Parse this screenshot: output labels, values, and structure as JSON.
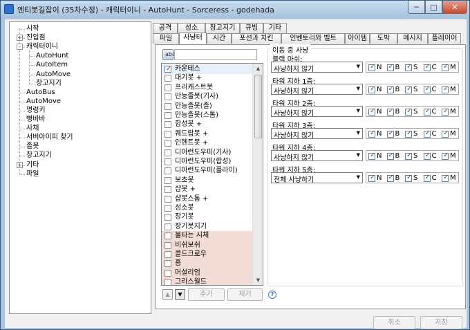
{
  "window": {
    "title": "엔티봇길잡이 (35차수정) - 캐릭터이니 - AutoHunt - Sorceress - godehada",
    "min_glyph": "─",
    "max_glyph": "□",
    "close_glyph": "✕"
  },
  "tree": {
    "items": [
      {
        "label": "시작",
        "level": 0,
        "expander": ""
      },
      {
        "label": "진입점",
        "level": 0,
        "expander": "+"
      },
      {
        "label": "캐릭터이니",
        "level": 0,
        "expander": "-"
      },
      {
        "label": "AutoHunt",
        "level": 1,
        "expander": ""
      },
      {
        "label": "AutoItem",
        "level": 1,
        "expander": ""
      },
      {
        "label": "AutoMove",
        "level": 1,
        "expander": ""
      },
      {
        "label": "창고지기",
        "level": 1,
        "expander": ""
      },
      {
        "label": "AutoBus",
        "level": 0,
        "expander": ""
      },
      {
        "label": "AutoMove",
        "level": 0,
        "expander": ""
      },
      {
        "label": "명령키",
        "level": 0,
        "expander": ""
      },
      {
        "label": "뻥바바",
        "level": 0,
        "expander": ""
      },
      {
        "label": "사채",
        "level": 0,
        "expander": ""
      },
      {
        "label": "서버아이피 찾기",
        "level": 0,
        "expander": ""
      },
      {
        "label": "졸봇",
        "level": 0,
        "expander": ""
      },
      {
        "label": "창고지기",
        "level": 0,
        "expander": ""
      },
      {
        "label": "기타",
        "level": 0,
        "expander": "+"
      },
      {
        "label": "파일",
        "level": 0,
        "expander": ""
      }
    ]
  },
  "tabs": {
    "row1": [
      "공격",
      "성소",
      "창고지기",
      "큐빙",
      "기타"
    ],
    "row2": [
      "파일",
      "사냥터",
      "시간",
      "포션과 치킨",
      "인벤토리와 벨트",
      "아이템",
      "도박",
      "메시지",
      "플레이어"
    ],
    "active": "사냥터"
  },
  "hunt_list": {
    "items": [
      {
        "label": "카운테스",
        "checked": true,
        "highlight": false
      },
      {
        "label": "대기봇 +",
        "checked": false,
        "highlight": false
      },
      {
        "label": "프리캐스트봇",
        "checked": false,
        "highlight": false
      },
      {
        "label": "만능졸봇(기사)",
        "checked": false,
        "highlight": false
      },
      {
        "label": "만능졸봇(졸)",
        "checked": false,
        "highlight": false
      },
      {
        "label": "만능졸봇(스톰)",
        "checked": false,
        "highlight": false
      },
      {
        "label": "합성봇 +",
        "checked": false,
        "highlight": false
      },
      {
        "label": "퀘드랍봇 +",
        "checked": false,
        "highlight": false
      },
      {
        "label": "인헨트봇 +",
        "checked": false,
        "highlight": false
      },
      {
        "label": "디아런도우미(기사)",
        "checked": false,
        "highlight": false
      },
      {
        "label": "디아런도우미(합성)",
        "checked": false,
        "highlight": false
      },
      {
        "label": "디아런도우미(플라이)",
        "checked": false,
        "highlight": false
      },
      {
        "label": "보초봇",
        "checked": false,
        "highlight": false
      },
      {
        "label": "샵봇 +",
        "checked": false,
        "highlight": false
      },
      {
        "label": "샵봇스톰 +",
        "checked": false,
        "highlight": false
      },
      {
        "label": "성소봇",
        "checked": false,
        "highlight": false
      },
      {
        "label": "장기봇",
        "checked": false,
        "highlight": false
      },
      {
        "label": "장기봇지기",
        "checked": false,
        "highlight": false
      },
      {
        "label": "불타는 시체",
        "checked": false,
        "highlight": true
      },
      {
        "label": "비쉬보쉬",
        "checked": false,
        "highlight": true
      },
      {
        "label": "콜드크로우",
        "checked": false,
        "highlight": true
      },
      {
        "label": "홈",
        "checked": false,
        "highlight": true
      },
      {
        "label": "머설리엄",
        "checked": false,
        "highlight": true
      },
      {
        "label": "그리스월드",
        "checked": false,
        "highlight": true
      }
    ]
  },
  "buttons": {
    "up_glyph": "▲",
    "down_glyph": "▼",
    "add": "추가",
    "remove": "제거",
    "help_glyph": "?",
    "cancel": "취소",
    "save": "저장"
  },
  "move_hunt": {
    "group_title": "이동 중 사냥",
    "flag_labels": [
      "N",
      "B",
      "S",
      "C",
      "M"
    ],
    "rows": [
      {
        "label": "블랙 마쉬:",
        "value": "사냥하지 않기",
        "flags": [
          true,
          true,
          true,
          true,
          true
        ]
      },
      {
        "label": "타워 지하 1층:",
        "value": "사냥하지 않기",
        "flags": [
          true,
          true,
          true,
          true,
          true
        ]
      },
      {
        "label": "타워 지하 2층:",
        "value": "사냥하지 않기",
        "flags": [
          true,
          true,
          true,
          true,
          true
        ]
      },
      {
        "label": "타워 지하 3층:",
        "value": "사냥하지 않기",
        "flags": [
          true,
          true,
          true,
          true,
          true
        ]
      },
      {
        "label": "타워 지하 4층:",
        "value": "사냥하지 않기",
        "flags": [
          true,
          true,
          true,
          true,
          true
        ]
      },
      {
        "label": "타워 지하 5층:",
        "value": "전체 사냥하기",
        "flags": [
          true,
          true,
          true,
          true,
          true
        ]
      }
    ]
  },
  "icons": {
    "toolbar": "list-options-icon",
    "app": "app-icon",
    "dropdown": "dropdown-arrow-icon"
  }
}
